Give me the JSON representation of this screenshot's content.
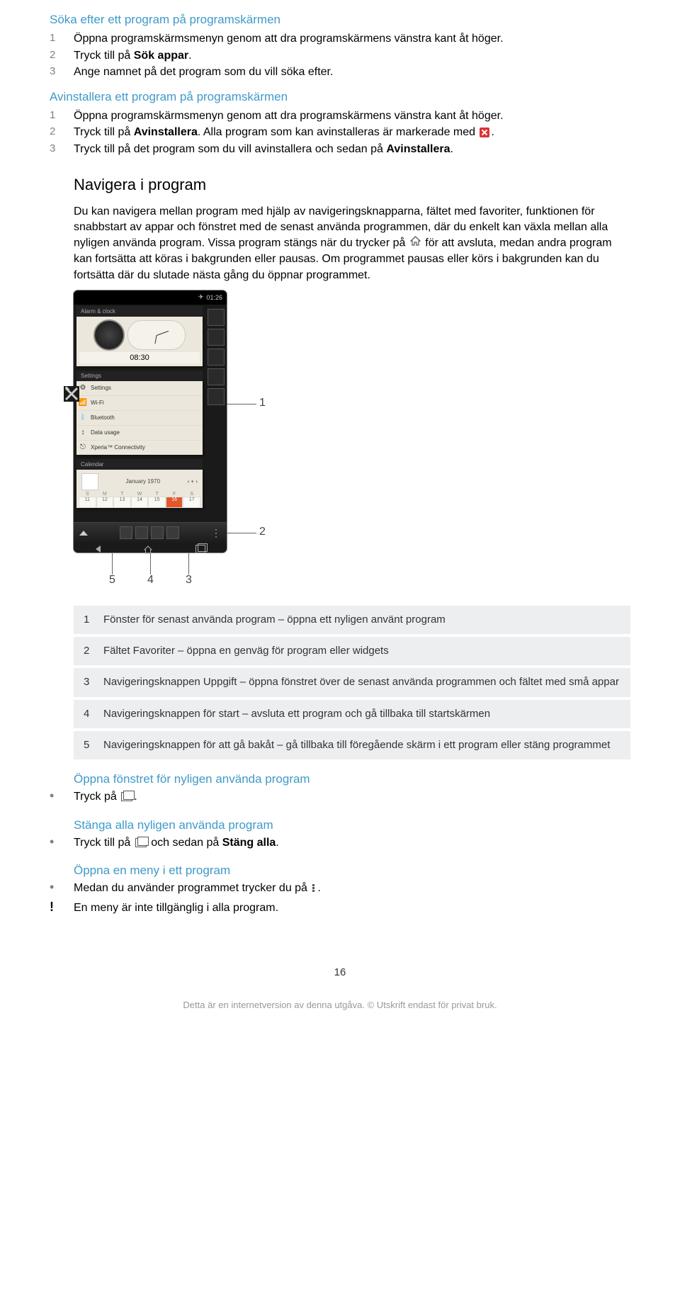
{
  "sec1": {
    "title": "Söka efter ett program på programskärmen",
    "steps": [
      "Öppna programskärmsmenyn genom att dra programskärmens vänstra kant åt höger.",
      [
        "Tryck till på ",
        "Sök appar",
        "."
      ],
      "Ange namnet på det program som du vill söka efter."
    ]
  },
  "sec2": {
    "title": "Avinstallera ett program på programskärmen",
    "steps": [
      "Öppna programskärmsmenyn genom att dra programskärmens vänstra kant åt höger.",
      [
        "Tryck till på ",
        "Avinstallera",
        ". Alla program som kan avinstalleras är markerade med "
      ],
      [
        "Tryck till på det program som du vill avinstallera och sedan på ",
        "Avinstallera",
        "."
      ]
    ]
  },
  "nav": {
    "title": "Navigera i program",
    "para_a": "Du kan navigera mellan program med hjälp av navigeringsknapparna, fältet med favoriter, funktionen för snabbstart av appar och fönstret med de senast använda programmen, där du enkelt kan växla mellan alla nyligen använda program. Vissa program stängs när du trycker på ",
    "para_b": " för att avsluta, medan andra program kan fortsätta att köras i bakgrunden eller pausas. Om programmet pausas eller körs i bakgrunden kan du fortsätta där du slutade nästa gång du öppnar programmet."
  },
  "phone": {
    "time_status": "01:26",
    "alarm_label": "Alarm & clock",
    "digital_time": "08:30",
    "settings_label": "Settings",
    "settings_items": [
      "Settings",
      "Wi-Fi",
      "Bluetooth",
      "Data usage",
      "Xperia™ Connectivity"
    ],
    "calendar_label": "Calendar",
    "cal_month": "January 1970",
    "cal_days": [
      "11",
      "12",
      "13",
      "14",
      "15",
      "16",
      "17"
    ]
  },
  "legend": [
    "Fönster för senast använda program – öppna ett nyligen använt program",
    "Fältet Favoriter – öppna en genväg för program eller widgets",
    "Navigeringsknappen Uppgift – öppna fönstret över de senast använda programmen och fältet med små appar",
    "Navigeringsknappen för start – avsluta ett program och gå tillbaka till startskärmen",
    "Navigeringsknappen för att gå bakåt – gå tillbaka till föregående skärm i ett program eller stäng programmet"
  ],
  "sub1": {
    "title": "Öppna fönstret för nyligen använda program",
    "bullet_a": "Tryck på ",
    "bullet_b": "."
  },
  "sub2": {
    "title": "Stänga alla nyligen använda program",
    "bullet_a": "Tryck till på ",
    "bullet_b": " och sedan på ",
    "bold": "Stäng alla",
    "bullet_c": "."
  },
  "sub3": {
    "title": "Öppna en meny i ett program",
    "bullet_a": "Medan du använder programmet trycker du på ",
    "bullet_b": ".",
    "note": "En meny är inte tillgänglig i alla program."
  },
  "page_num": "16",
  "footer": "Detta är en internetversion av denna utgåva. © Utskrift endast för privat bruk."
}
